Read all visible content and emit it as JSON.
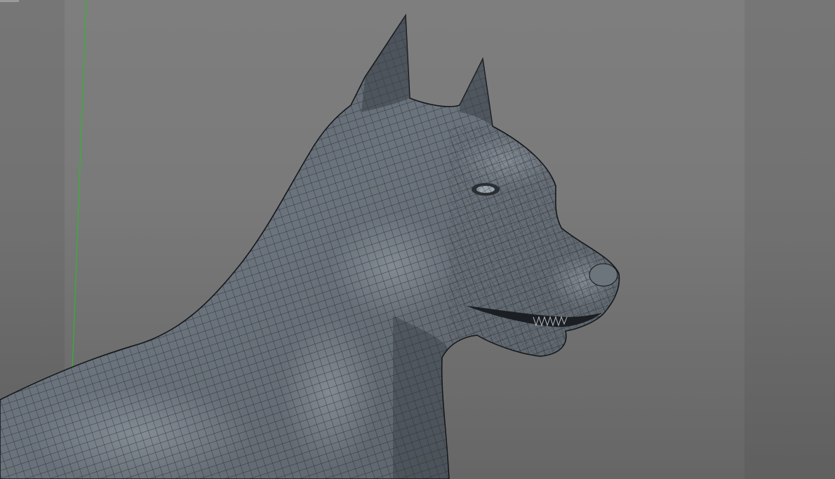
{
  "viewport": {
    "background_top": "#7e7e7e",
    "background_bottom": "#666666",
    "axis_color": "#2fb52f",
    "mesh_fill": "#5d646c",
    "mesh_line": "#1f2328",
    "model": "dog-head-wireframe-mesh"
  }
}
